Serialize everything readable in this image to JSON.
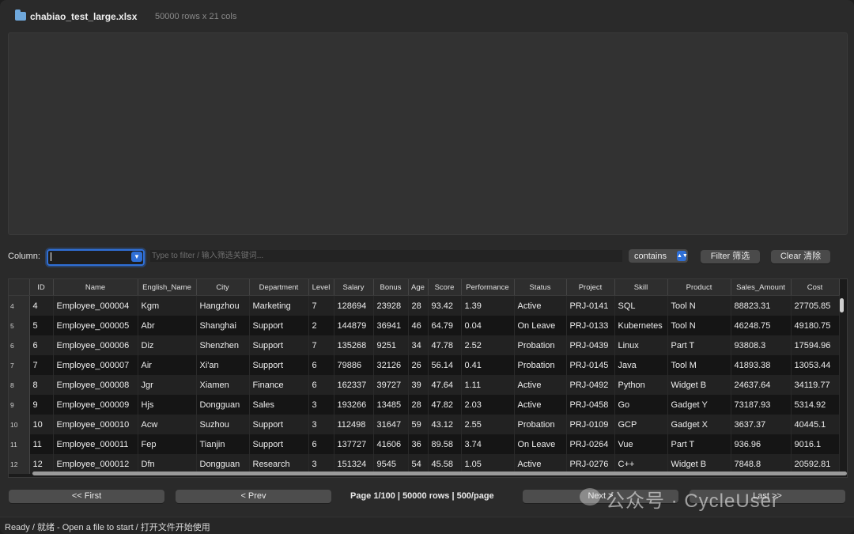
{
  "header": {
    "file_name": "chabiao_test_large.xlsx",
    "file_meta": "50000 rows x 21 cols"
  },
  "filter": {
    "column_label": "Column:",
    "column_value": "",
    "input_placeholder": "Type to filter / 输入筛选关键词...",
    "input_value": "",
    "mode": "contains",
    "filter_button": "Filter 筛选",
    "clear_button": "Clear 清除"
  },
  "table": {
    "columns": [
      "ID",
      "Name",
      "English_Name",
      "City",
      "Department",
      "Level",
      "Salary",
      "Bonus",
      "Age",
      "Score",
      "Performance",
      "Status",
      "Project",
      "Skill",
      "Product",
      "Sales_Amount",
      "Cost"
    ],
    "rows": [
      {
        "rownum": "4",
        "cells": [
          "4",
          "Employee_000004",
          "Kgm",
          "Hangzhou",
          "Marketing",
          "7",
          "128694",
          "23928",
          "28",
          "93.42",
          "1.39",
          "Active",
          "PRJ-0141",
          "SQL",
          "Tool N",
          "88823.31",
          "27705.85"
        ]
      },
      {
        "rownum": "5",
        "cells": [
          "5",
          "Employee_000005",
          "Abr",
          "Shanghai",
          "Support",
          "2",
          "144879",
          "36941",
          "46",
          "64.79",
          "0.04",
          "On Leave",
          "PRJ-0133",
          "Kubernetes",
          "Tool N",
          "46248.75",
          "49180.75"
        ]
      },
      {
        "rownum": "6",
        "cells": [
          "6",
          "Employee_000006",
          "Diz",
          "Shenzhen",
          "Support",
          "7",
          "135268",
          "9251",
          "34",
          "47.78",
          "2.52",
          "Probation",
          "PRJ-0439",
          "Linux",
          "Part T",
          "93808.3",
          "17594.96"
        ]
      },
      {
        "rownum": "7",
        "cells": [
          "7",
          "Employee_000007",
          "Air",
          "Xi'an",
          "Support",
          "6",
          "79886",
          "32126",
          "26",
          "56.14",
          "0.41",
          "Probation",
          "PRJ-0145",
          "Java",
          "Tool M",
          "41893.38",
          "13053.44"
        ]
      },
      {
        "rownum": "8",
        "cells": [
          "8",
          "Employee_000008",
          "Jgr",
          "Xiamen",
          "Finance",
          "6",
          "162337",
          "39727",
          "39",
          "47.64",
          "1.11",
          "Active",
          "PRJ-0492",
          "Python",
          "Widget B",
          "24637.64",
          "34119.77"
        ]
      },
      {
        "rownum": "9",
        "cells": [
          "9",
          "Employee_000009",
          "Hjs",
          "Dongguan",
          "Sales",
          "3",
          "193266",
          "13485",
          "28",
          "47.82",
          "2.03",
          "Active",
          "PRJ-0458",
          "Go",
          "Gadget Y",
          "73187.93",
          "5314.92"
        ]
      },
      {
        "rownum": "10",
        "cells": [
          "10",
          "Employee_000010",
          "Acw",
          "Suzhou",
          "Support",
          "3",
          "112498",
          "31647",
          "59",
          "43.12",
          "2.55",
          "Probation",
          "PRJ-0109",
          "GCP",
          "Gadget X",
          "3637.37",
          "40445.1"
        ]
      },
      {
        "rownum": "11",
        "cells": [
          "11",
          "Employee_000011",
          "Fep",
          "Tianjin",
          "Support",
          "6",
          "137727",
          "41606",
          "36",
          "89.58",
          "3.74",
          "On Leave",
          "PRJ-0264",
          "Vue",
          "Part T",
          "936.96",
          "9016.1"
        ]
      },
      {
        "rownum": "12",
        "cells": [
          "12",
          "Employee_000012",
          "Dfn",
          "Dongguan",
          "Research",
          "3",
          "151324",
          "9545",
          "54",
          "45.58",
          "1.05",
          "Active",
          "PRJ-0276",
          "C++",
          "Widget B",
          "7848.8",
          "20592.81"
        ]
      }
    ]
  },
  "pager": {
    "first": "<< First",
    "prev": "< Prev",
    "info": "Page 1/100 | 50000 rows | 500/page",
    "next": "Next >",
    "last": "Last >>"
  },
  "watermark": "公众号 · CycleUser",
  "status": "Ready / 就绪 - Open a file to start / 打开文件开始使用",
  "colors": {
    "accent": "#2f6fd6",
    "background": "#2a2a2a"
  }
}
